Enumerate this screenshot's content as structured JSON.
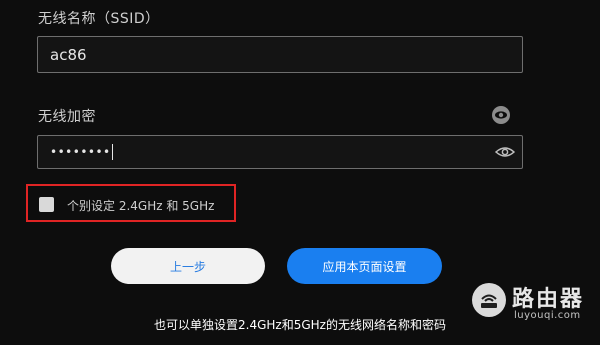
{
  "ssid": {
    "label": "无线名称（SSID）",
    "value": "ac86"
  },
  "encryption": {
    "label": "无线加密",
    "masked_value": "••••••••"
  },
  "separate_bands": {
    "label": "个别设定 2.4GHz 和 5GHz",
    "checked": false
  },
  "buttons": {
    "prev": "上一步",
    "apply": "应用本页面设置"
  },
  "note": "也可以单独设置2.4GHz和5GHz的无线网络名称和密码",
  "watermark": {
    "title": "路由器",
    "subtitle": "luyouqi.com"
  },
  "colors": {
    "background": "#0d0d0d",
    "accent": "#1a7ff0",
    "highlight": "#e02424"
  }
}
